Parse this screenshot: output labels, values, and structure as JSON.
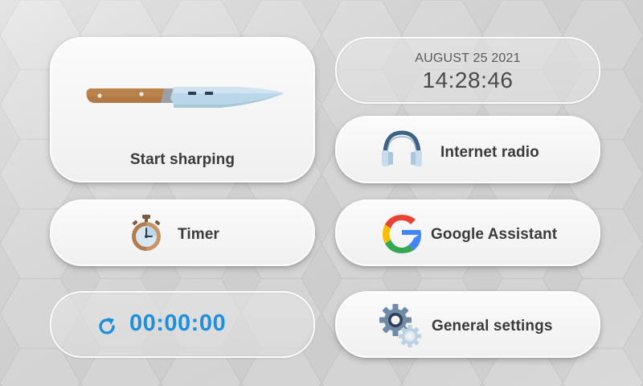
{
  "sharpen": {
    "label": "Start sharping"
  },
  "clock": {
    "date": "AUGUST 25 2021",
    "time": "14:28:46"
  },
  "radio": {
    "label": "Internet radio"
  },
  "timer": {
    "label": "Timer"
  },
  "google": {
    "label": "Google Assistant"
  },
  "countdown": {
    "value": "00:00:00"
  },
  "settings": {
    "label": "General settings"
  },
  "icons": {
    "knife": "knife-icon",
    "headphones": "headphones-icon",
    "stopwatch": "stopwatch-icon",
    "google": "google-icon",
    "refresh": "refresh-icon",
    "gears": "gears-icon"
  },
  "colors": {
    "countdown": "#1e8fdb",
    "label": "#3b3b3b",
    "background": "#dedede"
  }
}
